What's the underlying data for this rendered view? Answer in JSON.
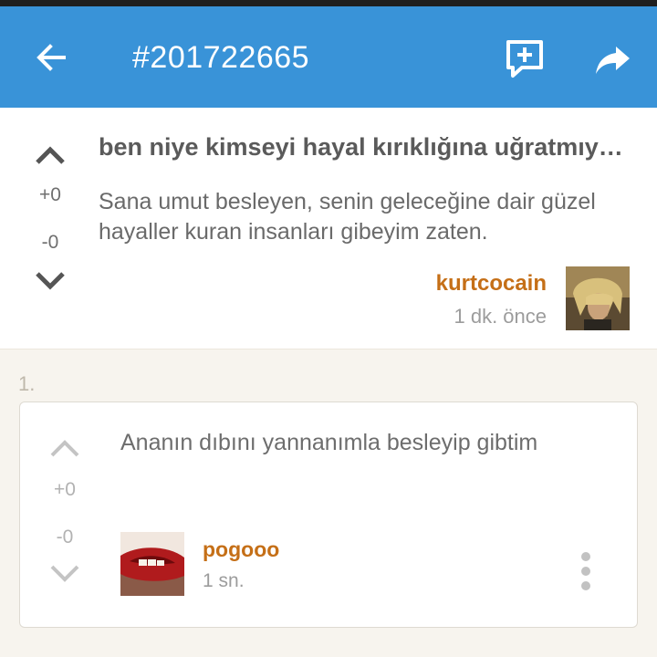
{
  "topbar": {
    "title": "#201722665",
    "back_icon": "arrow-left-icon",
    "comment_icon": "add-comment-icon",
    "share_icon": "share-icon"
  },
  "entry": {
    "upvotes": "+0",
    "downvotes": "-0",
    "title": "ben niye kimseyi hayal kırıklığına uğratmıyorum",
    "body": "Sana umut besleyen, senin geleceğine dair güzel hayaller kuran insanları gibeyim zaten.",
    "author": "kurtcocain",
    "time": "1 dk. önce"
  },
  "replies": [
    {
      "index": "1.",
      "upvotes": "+0",
      "downvotes": "-0",
      "text": "Ananın dıbını yannanımla besleyip gibtim",
      "author": "pogooo",
      "time": "1 sn."
    }
  ],
  "colors": {
    "appbar": "#3993d8",
    "author": "#c56f17",
    "background": "#f7f4ee"
  }
}
